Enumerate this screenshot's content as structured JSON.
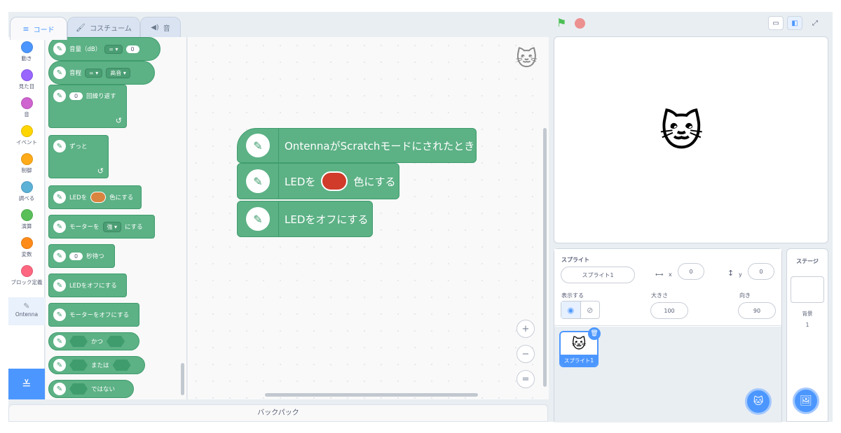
{
  "tabs": [
    {
      "label": "コード",
      "icon": "code-icon"
    },
    {
      "label": "コスチューム",
      "icon": "brush-icon"
    },
    {
      "label": "音",
      "icon": "speaker-icon"
    }
  ],
  "categories": [
    {
      "label": "動き",
      "color": "#4c97ff"
    },
    {
      "label": "見た目",
      "color": "#9966ff"
    },
    {
      "label": "音",
      "color": "#cf63cf"
    },
    {
      "label": "イベント",
      "color": "#ffd500"
    },
    {
      "label": "制御",
      "color": "#ffab19"
    },
    {
      "label": "調べる",
      "color": "#5cb1d6"
    },
    {
      "label": "演算",
      "color": "#59c059"
    },
    {
      "label": "変数",
      "color": "#ff8c1a"
    },
    {
      "label": "ブロック定義",
      "color": "#ff6680"
    },
    {
      "label": "Ontenna",
      "color": "#ffffff"
    }
  ],
  "palette": {
    "volume_label": "音量（dB）",
    "volume_op": "= ▾",
    "volume_value": "0",
    "pitch_label": "音程",
    "pitch_op": "= ▾",
    "pitch_value": "高音 ▾",
    "repeat_value": "0",
    "repeat_label": "回繰り返す",
    "forever_label": "ずっと",
    "led_color_pre": "LEDを",
    "led_color_post": "色にする",
    "motor_pre": "モーターを",
    "motor_value": "強 ▾",
    "motor_post": "にする",
    "wait_value": "0",
    "wait_label": "秒待つ",
    "led_off": "LEDをオフにする",
    "motor_off": "モーターをオフにする",
    "and_label": "かつ",
    "or_label": "または",
    "not_label": "ではない"
  },
  "script": {
    "hat_label": "OntennaがScratchモードにされたとき",
    "led_pre": "LEDを",
    "led_post": "色にする",
    "led_color": "#d03b2a",
    "led_off": "LEDをオフにする"
  },
  "zoom": {
    "in": "+",
    "out": "−",
    "reset": "="
  },
  "backpack": {
    "label": "バックパック"
  },
  "sprite": {
    "section_label": "スプライト",
    "name": "スプライト1",
    "x_label": "x",
    "x_value": "0",
    "y_label": "y",
    "y_value": "0",
    "show_label": "表示する",
    "size_label": "大きさ",
    "size_value": "100",
    "direction_label": "向き",
    "direction_value": "90",
    "thumb_label": "スプライト1"
  },
  "stage_panel": {
    "title": "ステージ",
    "backdrop_label": "背景",
    "backdrop_count": "1"
  },
  "colors": {
    "ontenna_block": "#5cb185",
    "accent": "#4c97ff"
  }
}
